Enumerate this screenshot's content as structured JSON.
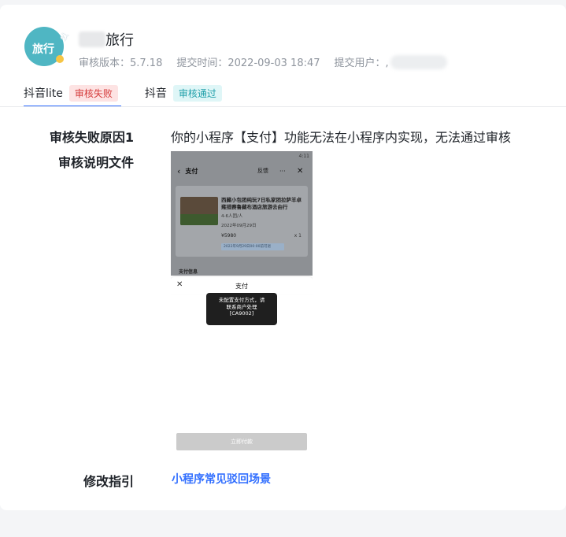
{
  "app": {
    "icon_text": "旅行",
    "title": "旅行",
    "meta": {
      "version": "审核版本：5.7.18",
      "submit_time": "提交时间：2022-09-03 18:47",
      "submit_user": "提交用户：,"
    }
  },
  "tabs": [
    {
      "name": "抖音lite",
      "status": "审核失败"
    },
    {
      "name": "抖音",
      "status": "审核通过"
    }
  ],
  "details": {
    "reason_label": "审核失败原因1",
    "reason_text": "你的小程序【支付】功能无法在小程序内实现，无法通过审核",
    "doc_label": "审核说明文件",
    "guide_label": "修改指引",
    "guide_link": "小程序常见驳回场景"
  },
  "screenshot": {
    "status_time": "4:11",
    "nav_title": "支付",
    "nav_feedback": "反馈",
    "nav_more": "···",
    "order_title": "西藏小包团纯玩7日私家团拉萨羊卓雍措赛鲁藏布酒店旅游去由行",
    "order_people": "4-6人团/人",
    "order_date": "2022年09月29日",
    "order_price": "¥5980",
    "order_qty": "x 1",
    "order_tag": "2022年9月29日00:00前可退",
    "pay_info": "支付信息",
    "sheet_title": "支付",
    "toast_line1": "未配置支付方式，请",
    "toast_line2": "联系商户处理",
    "toast_line3": "[CA9002]",
    "pay_button": "立即付款"
  },
  "colors": {
    "accent": "#3370ff",
    "fail_bg": "#fde3e3",
    "fail_text": "#d53b3b",
    "pass_bg": "#dff6f7",
    "pass_text": "#1f9fa9"
  }
}
